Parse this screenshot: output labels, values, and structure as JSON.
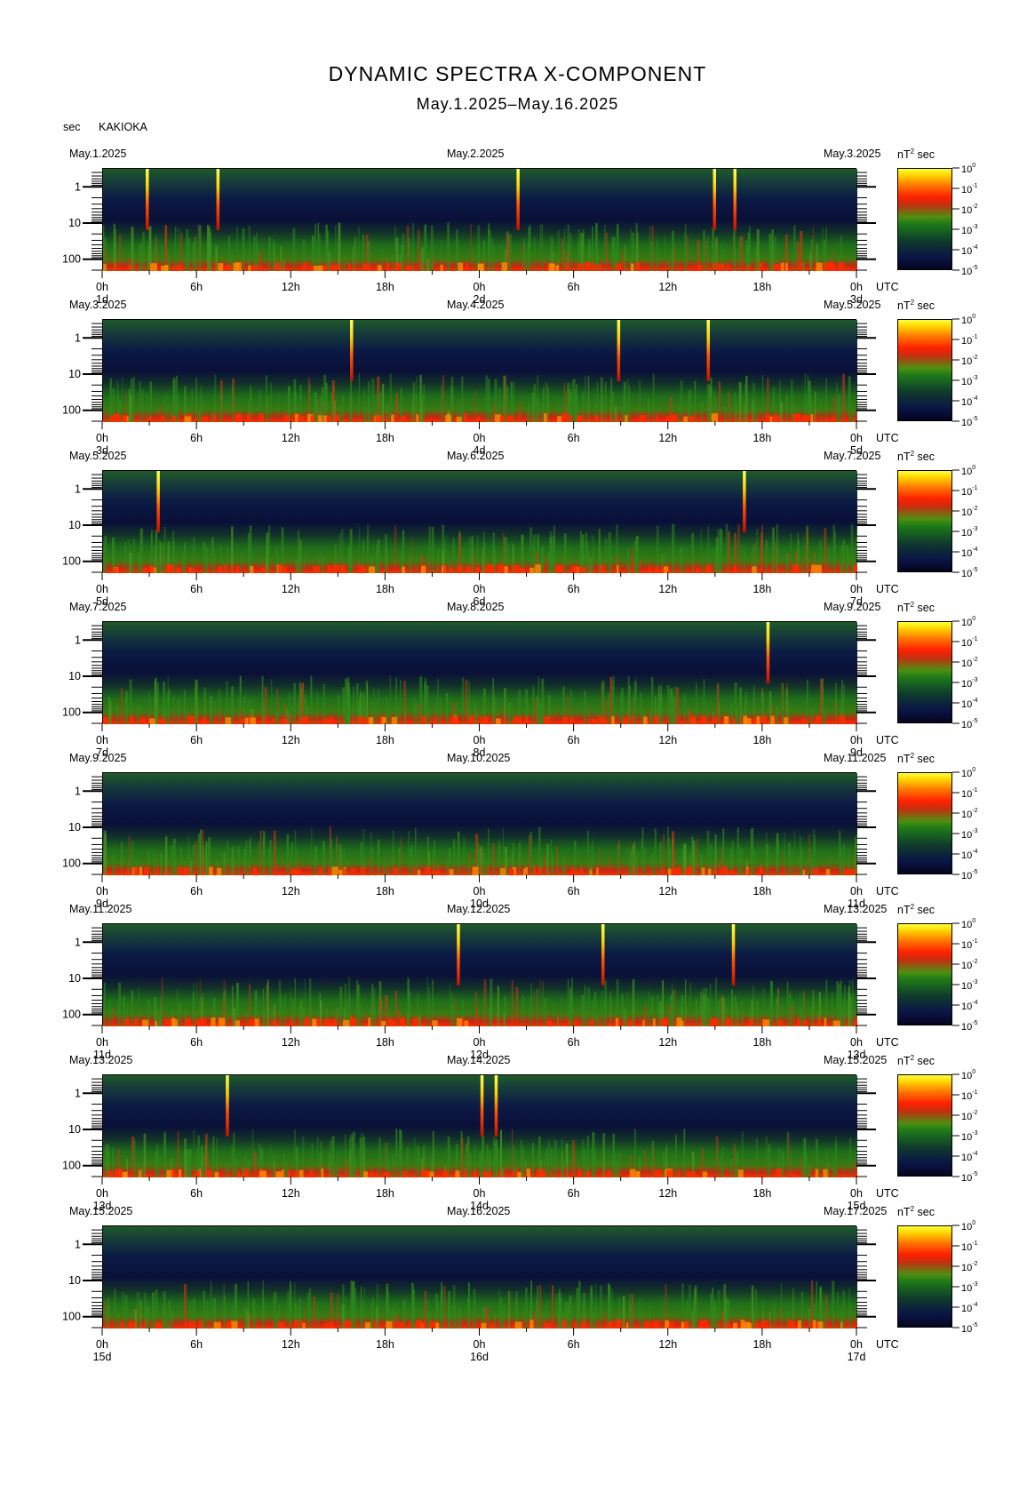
{
  "header": {
    "title": "DYNAMIC SPECTRA X-COMPONENT",
    "subtitle": "May.1.2025–May.16.2025",
    "y_unit": "sec",
    "station": "KAKIOKA"
  },
  "colorbar": {
    "unit_prefix": "nT",
    "unit_exp": "2",
    "unit_suffix": "sec",
    "ticks": [
      {
        "base": "10",
        "exp": "0"
      },
      {
        "base": "10",
        "exp": "-1"
      },
      {
        "base": "10",
        "exp": "-2"
      },
      {
        "base": "10",
        "exp": "-3"
      },
      {
        "base": "10",
        "exp": "-4"
      },
      {
        "base": "10",
        "exp": "-5"
      }
    ]
  },
  "y_ticks": [
    "1",
    "10",
    "100"
  ],
  "x_ticks": [
    "0h",
    "6h",
    "12h",
    "18h",
    "0h",
    "6h",
    "12h",
    "18h",
    "0h"
  ],
  "utc_label": "UTC",
  "panels": [
    {
      "start": "May.1.2025",
      "mid": "May.2.2025",
      "end": "May.3.2025",
      "d_start": "1d",
      "d_mid": "2d",
      "d_end": "3d"
    },
    {
      "start": "May.3.2025",
      "mid": "May.4.2025",
      "end": "May.5.2025",
      "d_start": "3d",
      "d_mid": "4d",
      "d_end": "5d"
    },
    {
      "start": "May.5.2025",
      "mid": "May.6.2025",
      "end": "May.7.2025",
      "d_start": "5d",
      "d_mid": "6d",
      "d_end": "7d"
    },
    {
      "start": "May.7.2025",
      "mid": "May.8.2025",
      "end": "May.9.2025",
      "d_start": "7d",
      "d_mid": "8d",
      "d_end": "9d"
    },
    {
      "start": "May.9.2025",
      "mid": "May.10.2025",
      "end": "May.11.2025",
      "d_start": "9d",
      "d_mid": "10d",
      "d_end": "11d"
    },
    {
      "start": "May.11.2025",
      "mid": "May.12.2025",
      "end": "May.13.2025",
      "d_start": "11d",
      "d_mid": "12d",
      "d_end": "13d"
    },
    {
      "start": "May.13.2025",
      "mid": "May.14.2025",
      "end": "May.15.2025",
      "d_start": "13d",
      "d_mid": "14d",
      "d_end": "15d"
    },
    {
      "start": "May.15.2025",
      "mid": "May.16.2025",
      "end": "May.17.2025",
      "d_start": "15d",
      "d_mid": "16d",
      "d_end": "17d"
    }
  ],
  "chart_data": {
    "type": "heatmap",
    "title": "DYNAMIC SPECTRA X-COMPONENT",
    "subtitle": "May.1.2025–May.16.2025",
    "xlabel": "UTC",
    "ylabel": "sec",
    "y_scale": "log",
    "y_ticks": [
      1,
      10,
      100
    ],
    "colorbar_label": "nT^2 sec",
    "colorbar_range": [
      1e-05,
      1
    ],
    "colorbar_scale": "log",
    "colors": {
      "low": "#05051c",
      "mid_low": "#0a1445",
      "mid": "#1d7a18",
      "high": "#ff2000",
      "peak": "#ffff40"
    },
    "panels": [
      {
        "from": "May.1.2025",
        "to": "May.3.2025",
        "spikes_hours": [
          2.8,
          7.3,
          26.4,
          38.9,
          40.2
        ]
      },
      {
        "from": "May.3.2025",
        "to": "May.5.2025",
        "spikes_hours": [
          15.8,
          32.8,
          38.5
        ]
      },
      {
        "from": "May.5.2025",
        "to": "May.7.2025",
        "spikes_hours": [
          3.5,
          40.8
        ]
      },
      {
        "from": "May.7.2025",
        "to": "May.9.2025",
        "spikes_hours": [
          42.3
        ]
      },
      {
        "from": "May.9.2025",
        "to": "May.11.2025",
        "spikes_hours": []
      },
      {
        "from": "May.11.2025",
        "to": "May.13.2025",
        "spikes_hours": [
          22.6,
          31.8,
          40.1
        ]
      },
      {
        "from": "May.13.2025",
        "to": "May.15.2025",
        "spikes_hours": [
          7.9,
          24.1,
          25.0
        ]
      },
      {
        "from": "May.15.2025",
        "to": "May.17.2025",
        "spikes_hours": []
      }
    ]
  }
}
